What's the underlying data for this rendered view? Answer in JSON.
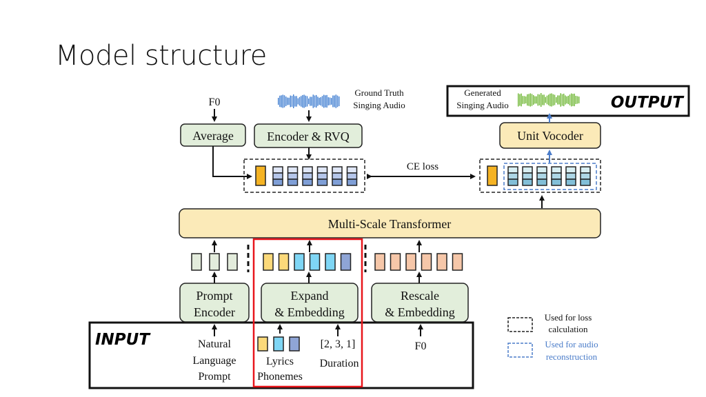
{
  "slide": {
    "title": "Model structure"
  },
  "colors": {
    "green_box": "#e2eedb",
    "yellow_box": "#fbeab8",
    "orange_token": "#f5b323",
    "rvq_light": "#dfe6f6",
    "rvq_mid": "#b5c6ea",
    "rvq_dark": "#7f9fd7",
    "out_light": "#d8eef2",
    "out_mid": "#aed7e6",
    "out_dark": "#82bfd8",
    "prompt_token": "#e3ecdc",
    "lyrics_yellow": "#fbd97a",
    "lyrics_cyan": "#7fd6f5",
    "lyrics_blue": "#8fa5d6",
    "f0_token": "#f6c7a9",
    "highlight_red": "#e8151b",
    "blue_dash": "#4a7cc9",
    "gt_audio": "#3b7bd0",
    "gen_audio": "#6bb52f"
  },
  "diagram": {
    "top": {
      "f0_label": "F0",
      "average_label": "Average",
      "encoder_rvq_label": "Encoder & RVQ",
      "gt_audio_line1": "Ground Truth",
      "gt_audio_line2": "Singing Audio",
      "ce_loss_label": "CE loss",
      "unit_vocoder_label": "Unit Vocoder"
    },
    "output": {
      "label": "OUTPUT",
      "gen_audio_line1": "Generated",
      "gen_audio_line2": "Singing Audio"
    },
    "transformer_label": "Multi-Scale Transformer",
    "encoders": {
      "prompt_line1": "Prompt",
      "prompt_line2": "Encoder",
      "expand_line1": "Expand",
      "expand_line2": "& Embedding",
      "rescale_line1": "Rescale",
      "rescale_line2": "& Embedding"
    },
    "input": {
      "label": "INPUT",
      "nl_line1": "Natural",
      "nl_line2": "Language",
      "nl_line3": "Prompt",
      "lyrics_line1": "Lyrics",
      "lyrics_line2": "Phonemes",
      "duration_value": "[2, 3, 1]",
      "duration_label": "Duration",
      "f0_label": "F0"
    },
    "legend": {
      "loss_line1": "Used for loss",
      "loss_line2": "calculation",
      "recon_line1": "Used for audio",
      "recon_line2": "reconstruction"
    }
  }
}
